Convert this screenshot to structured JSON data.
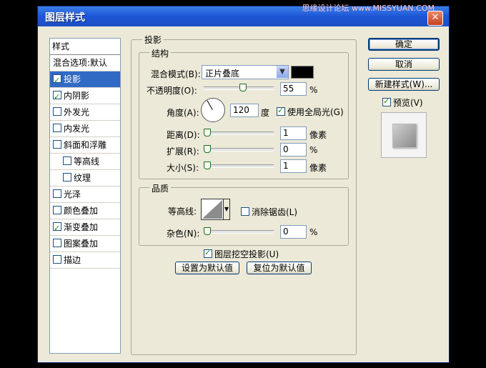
{
  "window": {
    "title": "图层样式",
    "watermark": "思缘设计论坛 www.MISSYUAN.COM",
    "close_label": "✕"
  },
  "styles_panel": {
    "header": "样式",
    "items": [
      {
        "label": "混合选项:默认",
        "checkbox": false,
        "checked": false,
        "selected": false
      },
      {
        "label": "投影",
        "checkbox": true,
        "checked": true,
        "selected": true
      },
      {
        "label": "内阴影",
        "checkbox": true,
        "checked": true,
        "selected": false
      },
      {
        "label": "外发光",
        "checkbox": true,
        "checked": false,
        "selected": false
      },
      {
        "label": "内发光",
        "checkbox": true,
        "checked": false,
        "selected": false
      },
      {
        "label": "斜面和浮雕",
        "checkbox": true,
        "checked": false,
        "selected": false
      },
      {
        "label": "等高线",
        "checkbox": true,
        "checked": false,
        "selected": false
      },
      {
        "label": "纹理",
        "checkbox": true,
        "checked": false,
        "selected": false
      },
      {
        "label": "光泽",
        "checkbox": true,
        "checked": false,
        "selected": false
      },
      {
        "label": "颜色叠加",
        "checkbox": true,
        "checked": false,
        "selected": false
      },
      {
        "label": "渐变叠加",
        "checkbox": true,
        "checked": true,
        "selected": false
      },
      {
        "label": "图案叠加",
        "checkbox": true,
        "checked": false,
        "selected": false
      },
      {
        "label": "描边",
        "checkbox": true,
        "checked": false,
        "selected": false
      }
    ]
  },
  "drop_shadow": {
    "title": "投影",
    "structure": {
      "title": "结构",
      "blend_mode_label": "混合模式(B):",
      "blend_mode_value": "正片叠底",
      "shadow_color": "#000000",
      "opacity_label": "不透明度(O):",
      "opacity_value": "55",
      "opacity_unit": "%",
      "angle_label": "角度(A):",
      "angle_value": "120",
      "angle_unit": "度",
      "global_light_label": "使用全局光(G)",
      "global_light_checked": true,
      "distance_label": "距离(D):",
      "distance_value": "1",
      "distance_unit": "像素",
      "spread_label": "扩展(R):",
      "spread_value": "0",
      "spread_unit": "%",
      "size_label": "大小(S):",
      "size_value": "1",
      "size_unit": "像素"
    },
    "quality": {
      "title": "品质",
      "contour_label": "等高线:",
      "antialias_label": "消除锯齿(L)",
      "antialias_checked": false,
      "noise_label": "杂色(N):",
      "noise_value": "0",
      "noise_unit": "%"
    },
    "knockout_label": "图层挖空投影(U)",
    "knockout_checked": true,
    "make_default_label": "设置为默认值",
    "reset_default_label": "复位为默认值"
  },
  "buttons": {
    "ok": "确定",
    "cancel": "取消",
    "new_style": "新建样式(W)...",
    "preview_label": "预览(V)",
    "preview_checked": true
  }
}
